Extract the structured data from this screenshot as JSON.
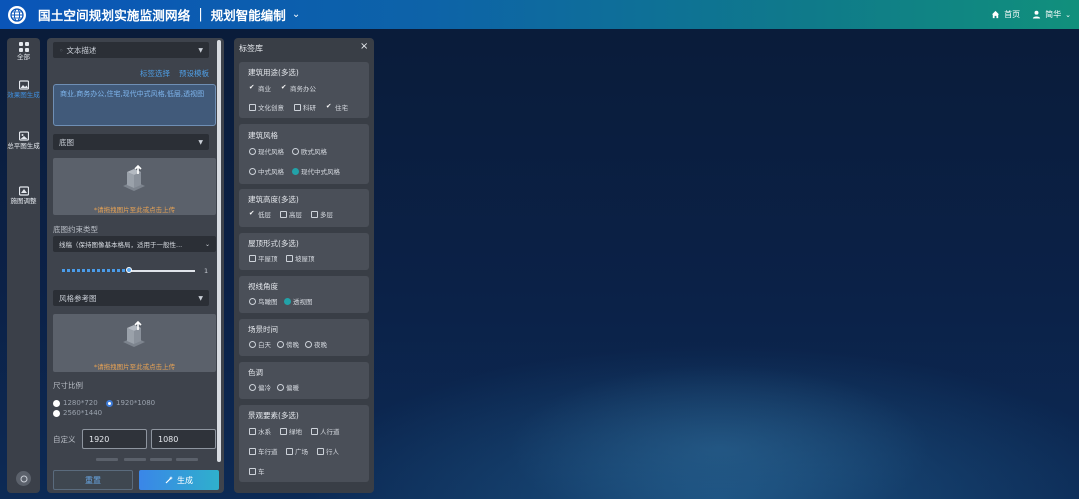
{
  "colors": {
    "accent": "#3a86e8",
    "header_start": "#0a55b8",
    "header_end": "#11907c",
    "warning_text": "#e7a254"
  },
  "header": {
    "app_title": "国土空间规划实施监测网络",
    "separator": "|",
    "module_title": "规划智能编制",
    "home_label": "首页",
    "user_label": "简华"
  },
  "rail": {
    "items": [
      {
        "label": "全部",
        "icon": "grid-icon"
      },
      {
        "label": "效果图生成",
        "icon": "image-icon"
      },
      {
        "label": "总平图生成",
        "icon": "picture-icon"
      },
      {
        "label": "施图调整",
        "icon": "adjust-icon"
      }
    ]
  },
  "form": {
    "text_desc_label": "文本描述",
    "tag_select_link": "标签选择",
    "preset_template_link": "预设模板",
    "prompt_value": "商业,商务办公,住宅,现代中式风格,低层,透视图",
    "base_image_label": "底图",
    "upload_hint": "*请拖拽图片至此或点击上传",
    "constraint_label": "底图约束类型",
    "constraint_value": "线稿（保持图像基本格局，适用于一般性...",
    "slider_value": "1",
    "slider_level": 0.5,
    "style_ref_label": "风格参考图",
    "style_upload_hint": "*请拖拽图片至此或点击上传",
    "size_label": "尺寸比例",
    "size_options": [
      "1280*720",
      "1920*1080",
      "2560*1440"
    ],
    "size_selected": "1920*1080",
    "custom_label": "自定义",
    "width_value": "1920",
    "height_value": "1080",
    "reset_label": "重置",
    "generate_label": "生成"
  },
  "tags": {
    "title": "标签库",
    "close_glyph": "×",
    "groups": [
      {
        "title": "建筑用途(多选)",
        "options": [
          {
            "label": "商业",
            "checked": true
          },
          {
            "label": "商务办公",
            "checked": true
          },
          {
            "label": "文化创意",
            "checked": false
          },
          {
            "label": "科研",
            "checked": false
          },
          {
            "label": "住宅",
            "checked": true
          }
        ]
      },
      {
        "title": "建筑风格",
        "options": [
          {
            "label": "现代风格",
            "checked": false
          },
          {
            "label": "欧式风格",
            "checked": false
          },
          {
            "label": "中式风格",
            "checked": false
          },
          {
            "label": "现代中式风格",
            "checked": true
          }
        ]
      },
      {
        "title": "建筑高度(多选)",
        "options": [
          {
            "label": "低层",
            "checked": true
          },
          {
            "label": "高层",
            "checked": false
          },
          {
            "label": "多层",
            "checked": false
          }
        ]
      },
      {
        "title": "屋顶形式(多选)",
        "options": [
          {
            "label": "平屋顶",
            "checked": false
          },
          {
            "label": "坡屋顶",
            "checked": false
          }
        ]
      },
      {
        "title": "视线角度",
        "options": [
          {
            "label": "鸟瞰图",
            "checked": false
          },
          {
            "label": "透视图",
            "checked": true
          }
        ]
      },
      {
        "title": "场景时间",
        "options": [
          {
            "label": "白天",
            "checked": false
          },
          {
            "label": "傍晚",
            "checked": false
          },
          {
            "label": "夜晚",
            "checked": false
          }
        ]
      },
      {
        "title": "色调",
        "options": [
          {
            "label": "偏冷",
            "checked": false
          },
          {
            "label": "偏暖",
            "checked": false
          }
        ]
      },
      {
        "title": "景观要素(多选)",
        "options": [
          {
            "label": "水系",
            "checked": false
          },
          {
            "label": "绿地",
            "checked": false
          },
          {
            "label": "人行道",
            "checked": false
          },
          {
            "label": "车行道",
            "checked": false
          },
          {
            "label": "广场",
            "checked": false
          },
          {
            "label": "行人",
            "checked": false
          },
          {
            "label": "车",
            "checked": false
          }
        ]
      }
    ]
  }
}
